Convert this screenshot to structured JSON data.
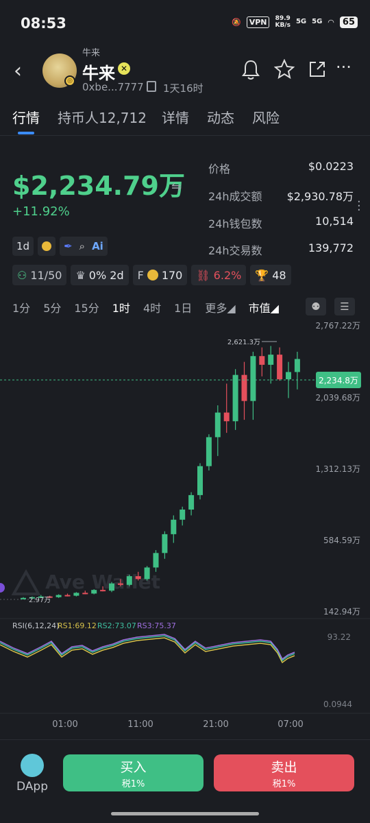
{
  "status_bar": {
    "time": "08:53",
    "vpn": "VPN",
    "speed_value": "89.9",
    "speed_unit": "KB/s",
    "network1": "5G",
    "network2": "5G",
    "battery": "65"
  },
  "header": {
    "subtitle": "牛来",
    "token_name": "牛来",
    "address": "0xbe...7777",
    "age": "1天16时",
    "icons": [
      "back-icon",
      "bell-icon",
      "star-icon",
      "share-icon",
      "more-icon"
    ]
  },
  "tabs": [
    {
      "label": "行情",
      "active": true
    },
    {
      "label": "持币人12,712",
      "active": false
    },
    {
      "label": "详情",
      "active": false
    },
    {
      "label": "动态",
      "active": false
    },
    {
      "label": "风险",
      "active": false
    }
  ],
  "summary": {
    "market_cap": "$2,234.79万",
    "change": "+11.92%"
  },
  "stats": [
    {
      "label": "价格",
      "value": "$0.0223"
    },
    {
      "label": "24h成交额",
      "value": "$2,930.78万"
    },
    {
      "label": "24h钱包数",
      "value": "10,514"
    },
    {
      "label": "24h交易数",
      "value": "139,772"
    }
  ],
  "chips_row1": {
    "timeframe": "1d",
    "ai": "Ai"
  },
  "chips_row2": [
    {
      "icon": "user-icon",
      "text": "11/50"
    },
    {
      "icon": "chef-icon",
      "text": "0% 2d"
    },
    {
      "prefix": "F",
      "icon": "coin-icon",
      "text": "170"
    },
    {
      "icon": "chain-icon",
      "text": "6.2%"
    },
    {
      "icon": "trophy-icon",
      "text": "48"
    }
  ],
  "intervals": [
    {
      "label": "1分",
      "active": false
    },
    {
      "label": "5分",
      "active": false
    },
    {
      "label": "15分",
      "active": false
    },
    {
      "label": "1时",
      "active": true
    },
    {
      "label": "4时",
      "active": false
    },
    {
      "label": "1日",
      "active": false
    },
    {
      "label": "更多◢",
      "active": false
    },
    {
      "label": "市值◢",
      "active": true
    }
  ],
  "chart_data": {
    "type": "candlestick",
    "y_ticks": [
      "2,767.22万",
      "2,039.68万",
      "1,312.13万",
      "584.59万",
      "142.94万"
    ],
    "current_label": "2,234.8万",
    "high_annotation": "2,621.3万",
    "low_annotation": "2.97万",
    "watermark": "Ave Wallet",
    "x_ticks": [
      "01:00",
      "11:00",
      "21:00",
      "07:00"
    ],
    "rsi": {
      "label": "RSI(6,12,24)",
      "rsi1": "RS1:69.12",
      "rsi2": "RS2:73.07",
      "rsi3": "RS3:75.37",
      "top": "93.22",
      "bottom": "0.0944",
      "colors": {
        "rsi1": "#d6c14a",
        "rsi2": "#3fbfa0",
        "rsi3": "#a070e0"
      }
    },
    "colors": {
      "up": "#3fbf85",
      "down": "#e4505c"
    },
    "candles": [
      {
        "o": 3,
        "h": 5,
        "l": 2,
        "c": 4
      },
      {
        "o": 4,
        "h": 6,
        "l": 3,
        "c": 5
      },
      {
        "o": 5,
        "h": 8,
        "l": 4,
        "c": 6
      },
      {
        "o": 6,
        "h": 7,
        "l": 4,
        "c": 5
      },
      {
        "o": 5,
        "h": 9,
        "l": 4,
        "c": 8
      },
      {
        "o": 8,
        "h": 10,
        "l": 6,
        "c": 7
      },
      {
        "o": 7,
        "h": 12,
        "l": 6,
        "c": 11
      },
      {
        "o": 11,
        "h": 14,
        "l": 9,
        "c": 10
      },
      {
        "o": 10,
        "h": 16,
        "l": 9,
        "c": 15
      },
      {
        "o": 15,
        "h": 20,
        "l": 13,
        "c": 14
      },
      {
        "o": 14,
        "h": 26,
        "l": 12,
        "c": 24
      },
      {
        "o": 24,
        "h": 30,
        "l": 20,
        "c": 22
      },
      {
        "o": 22,
        "h": 36,
        "l": 20,
        "c": 34
      },
      {
        "o": 34,
        "h": 40,
        "l": 28,
        "c": 30
      },
      {
        "o": 30,
        "h": 48,
        "l": 28,
        "c": 46
      },
      {
        "o": 46,
        "h": 70,
        "l": 40,
        "c": 66
      },
      {
        "o": 66,
        "h": 96,
        "l": 58,
        "c": 92
      },
      {
        "o": 92,
        "h": 118,
        "l": 80,
        "c": 112
      },
      {
        "o": 112,
        "h": 130,
        "l": 104,
        "c": 126
      },
      {
        "o": 126,
        "h": 150,
        "l": 118,
        "c": 146
      },
      {
        "o": 146,
        "h": 190,
        "l": 140,
        "c": 186
      },
      {
        "o": 186,
        "h": 230,
        "l": 180,
        "c": 226
      },
      {
        "o": 226,
        "h": 270,
        "l": 200,
        "c": 260
      },
      {
        "o": 260,
        "h": 300,
        "l": 232,
        "c": 248
      },
      {
        "o": 248,
        "h": 320,
        "l": 236,
        "c": 312
      },
      {
        "o": 312,
        "h": 330,
        "l": 250,
        "c": 276
      },
      {
        "o": 276,
        "h": 344,
        "l": 250,
        "c": 338
      },
      {
        "o": 338,
        "h": 350,
        "l": 310,
        "c": 326
      },
      {
        "o": 326,
        "h": 352,
        "l": 300,
        "c": 340
      },
      {
        "o": 340,
        "h": 350,
        "l": 304,
        "c": 306
      },
      {
        "o": 306,
        "h": 330,
        "l": 280,
        "c": 316
      },
      {
        "o": 316,
        "h": 344,
        "l": 292,
        "c": 334
      }
    ]
  },
  "bottom_bar": {
    "dapp": "DApp",
    "buy": "买入",
    "buy_tax": "税1%",
    "sell": "卖出",
    "sell_tax": "税1%"
  }
}
